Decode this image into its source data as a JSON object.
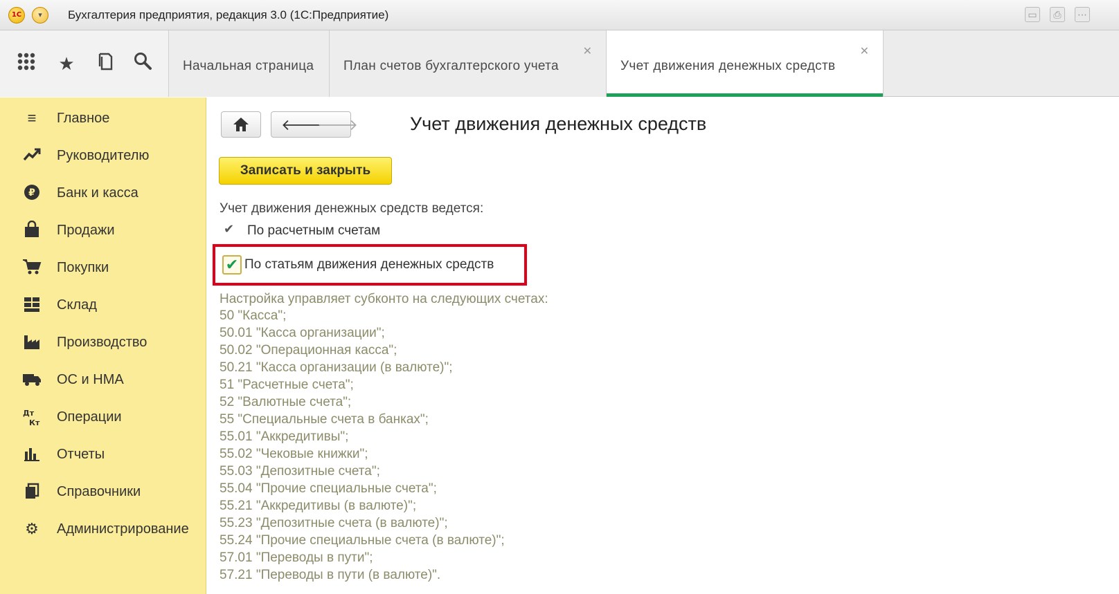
{
  "window": {
    "title": "Бухгалтерия предприятия, редакция 3.0  (1С:Предприятие)",
    "logo_text": "1С"
  },
  "tabs": [
    {
      "label": "Начальная страница",
      "closable": false,
      "active": false
    },
    {
      "label": "План счетов бухгалтерского учета",
      "closable": true,
      "active": false
    },
    {
      "label": "Учет движения денежных средств",
      "closable": true,
      "active": true
    }
  ],
  "sidebar": {
    "items": [
      {
        "label": "Главное",
        "icon": "menu-lines-icon"
      },
      {
        "label": "Руководителю",
        "icon": "trend-icon"
      },
      {
        "label": "Банк и касса",
        "icon": "ruble-coin-icon"
      },
      {
        "label": "Продажи",
        "icon": "shopping-bag-icon"
      },
      {
        "label": "Покупки",
        "icon": "cart-icon"
      },
      {
        "label": "Склад",
        "icon": "warehouse-grid-icon"
      },
      {
        "label": "Производство",
        "icon": "factory-icon"
      },
      {
        "label": "ОС и НМА",
        "icon": "truck-icon"
      },
      {
        "label": "Операции",
        "icon": "dt-kt-icon"
      },
      {
        "label": "Отчеты",
        "icon": "bar-chart-icon"
      },
      {
        "label": "Справочники",
        "icon": "books-icon"
      },
      {
        "label": "Администрирование",
        "icon": "gear-icon"
      }
    ]
  },
  "form": {
    "title": "Учет движения денежных средств",
    "save_label": "Записать и закрыть",
    "intro": "Учет движения денежных средств ведется:",
    "option_settlement": "По расчетным счетам",
    "option_cashflow": "По статьям движения денежных средств",
    "option_cashflow_checked": true,
    "note": "Настройка управляет субконто на следующих счетах:",
    "accounts": [
      "50 \"Касса\";",
      "50.01 \"Касса организации\";",
      "50.02 \"Операционная касса\";",
      "50.21 \"Касса организации (в валюте)\";",
      "51 \"Расчетные счета\";",
      "52 \"Валютные счета\";",
      "55 \"Специальные счета в банках\";",
      "55.01 \"Аккредитивы\";",
      "55.02 \"Чековые книжки\";",
      "55.03 \"Депозитные счета\";",
      "55.04 \"Прочие специальные счета\";",
      "55.21 \"Аккредитивы (в валюте)\";",
      "55.23 \"Депозитные счета (в валюте)\";",
      "55.24 \"Прочие специальные счета (в валюте)\";",
      "57.01 \"Переводы в пути\";",
      "57.21 \"Переводы в пути (в валюте)\"."
    ]
  },
  "colors": {
    "sidebar_bg": "#fbec99",
    "active_tab_underline": "#1fa05a",
    "save_button": "#f4d200",
    "highlight_border": "#e0001a"
  }
}
